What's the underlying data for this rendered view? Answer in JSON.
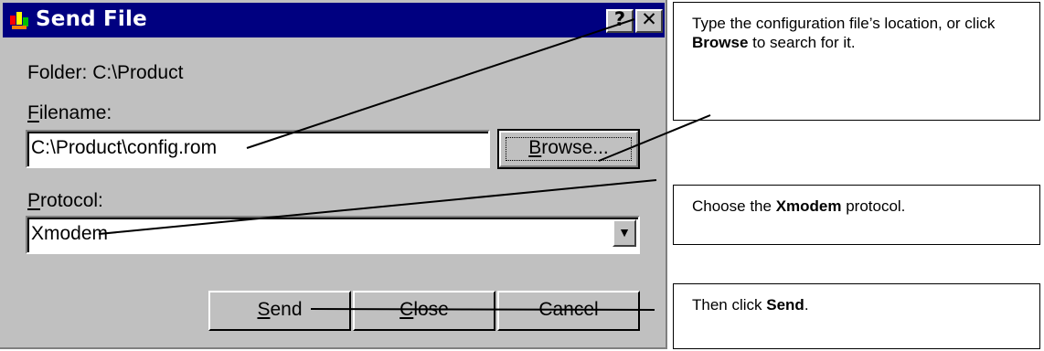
{
  "dialog": {
    "title": "Send File",
    "help_button": "?",
    "close_button": "✕",
    "folder_label": "Folder:",
    "folder_value": "C:\\Product",
    "filename_label_accel": "F",
    "filename_label_rest": "ilename:",
    "filename_value": "C:\\Product\\config.rom",
    "browse_accel": "B",
    "browse_rest": "rowse...",
    "protocol_label_accel": "P",
    "protocol_label_rest": "rotocol:",
    "protocol_value": "Xmodem",
    "send_accel": "S",
    "send_rest": "end",
    "close_accel": "C",
    "close_rest": "lose",
    "cancel_label": "Cancel"
  },
  "callouts": {
    "c1_pre": "Type the configuration file’s location, or click ",
    "c1_bold": "Browse",
    "c1_post": " to search for it.",
    "c2_pre": "Choose the ",
    "c2_bold": "Xmodem",
    "c2_post": " protocol.",
    "c3_pre": "Then click ",
    "c3_bold": "Send",
    "c3_post": "."
  },
  "colors": {
    "title_bar": "#000080",
    "dialog_face": "#c0c0c0"
  }
}
